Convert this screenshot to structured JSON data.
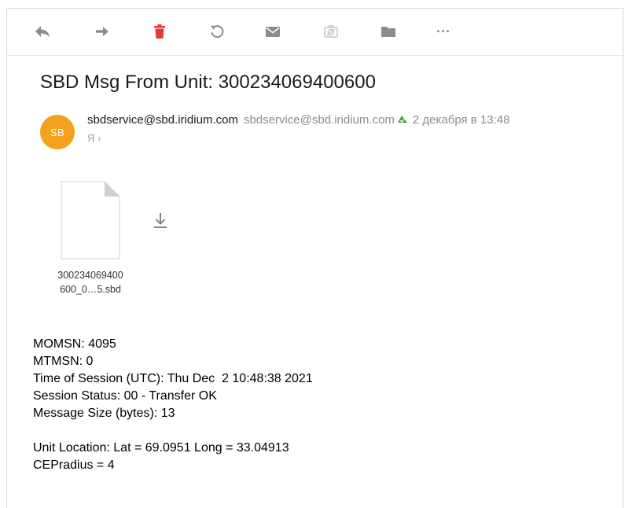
{
  "toolbar": {
    "icons": [
      "reply-icon",
      "forward-icon",
      "delete-icon",
      "mark-unread-icon",
      "mail-icon",
      "spam-icon",
      "folder-icon",
      "more-icon"
    ],
    "more_label": "···",
    "delete_color": "#e53935",
    "icon_color": "#8c8c8c"
  },
  "message": {
    "subject": "SBD Msg From Unit: 300234069400600",
    "sender": {
      "initials": "SB",
      "name": "sbdservice@sbd.iridium.com",
      "email": "sbdservice@sbd.iridium.com",
      "avatar_color": "#f4a21d"
    },
    "date": "2 декабря в 13:48",
    "recipient": "Я",
    "recipient_chevron": "›",
    "attachment": {
      "name_line1": "300234069400",
      "name_line2": "600_0…5.sbd"
    },
    "body": {
      "line1": "MOMSN: 4095",
      "line2": "MTMSN: 0",
      "line3": "Time of Session (UTC): Thu Dec  2 10:48:38 2021",
      "line4": "Session Status: 00 - Transfer OK",
      "line5": "Message Size (bytes): 13",
      "line6": "Unit Location: Lat = 69.0951 Long = 33.04913",
      "line7": "CEPradius = 4"
    }
  }
}
